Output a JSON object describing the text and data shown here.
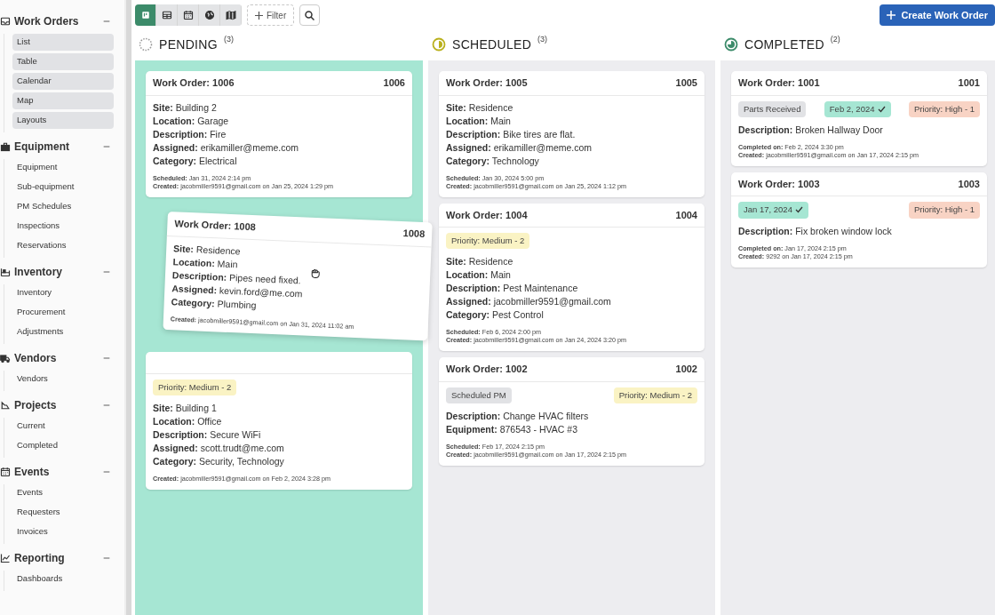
{
  "sidebar": {
    "groups": [
      {
        "title": "Work Orders",
        "expanded": true,
        "kind": "buttons",
        "items": [
          "List",
          "Table",
          "Calendar",
          "Map",
          "Layouts"
        ]
      },
      {
        "title": "Equipment",
        "expanded": true,
        "kind": "links",
        "items": [
          "Equipment",
          "Sub-equipment",
          "PM Schedules",
          "Inspections",
          "Reservations"
        ]
      },
      {
        "title": "Inventory",
        "expanded": true,
        "kind": "links",
        "items": [
          "Inventory",
          "Procurement",
          "Adjustments"
        ]
      },
      {
        "title": "Vendors",
        "expanded": true,
        "kind": "links",
        "items": [
          "Vendors"
        ]
      },
      {
        "title": "Projects",
        "expanded": true,
        "kind": "links",
        "items": [
          "Current",
          "Completed"
        ]
      },
      {
        "title": "Events",
        "expanded": true,
        "kind": "links",
        "items": [
          "Events",
          "Requesters",
          "Invoices"
        ]
      },
      {
        "title": "Reporting",
        "expanded": true,
        "kind": "links",
        "items": [
          "Dashboards"
        ]
      }
    ]
  },
  "toolbar": {
    "views": [
      {
        "selected": true
      },
      {
        "selected": false
      },
      {
        "selected": false
      },
      {
        "selected": false
      },
      {
        "selected": false
      }
    ],
    "filter": "Filter",
    "create": "Create Work Order"
  },
  "columns": [
    {
      "title": "PENDING",
      "count": "(3)",
      "highlighted": true,
      "cards": [
        {
          "title": "Work Order: 1006",
          "number": "1006",
          "fields": [
            "**Site:** Building 2",
            "**Location:** Garage",
            "**Description:** Fire",
            "**Assigned:** erikamiller@meme.com",
            "**Category:** Electrical"
          ],
          "footer": [
            "**Scheduled:** Jan 31, 2024 2:14 pm",
            "**Created:** jacobmiller9591@gmail.com on Jan 25, 2024 1:29 pm"
          ]
        },
        {
          "badges": [
            {
              "kind": "priority",
              "text": "Priority: Medium - 2",
              "color": "#faf3c4"
            }
          ],
          "fields": [
            "**Site:** Building 1",
            "**Location:** Office",
            "**Description:** Secure WiFi",
            "**Assigned:** scott.trudt@me.com",
            "**Category:** Security, Technology"
          ],
          "footer": [
            "**Created:** jacobmiller9591@gmail.com on Feb 2, 2024 3:28 pm"
          ]
        }
      ],
      "dragged_card": {
        "title": "Work Order: 1008",
        "number": "1008",
        "fields": [
          "**Site:** Residence",
          "**Location:** Main",
          "**Description:** Pipes need fixed.",
          "**Assigned:** kevin.ford@me.com",
          "**Category:** Plumbing"
        ],
        "footer": [
          "**Created:** jacobmiller9591@gmail.com on Jan 31, 2024 11:02 am"
        ]
      }
    },
    {
      "title": "SCHEDULED",
      "count": "(3)",
      "highlighted": false,
      "cards": [
        {
          "title": "Work Order: 1005",
          "number": "1005",
          "fields": [
            "**Site:** Residence",
            "**Location:** Main",
            "**Description:** Bike tires are flat.",
            "**Assigned:** erikamiller@meme.com",
            "**Category:** Technology"
          ],
          "footer": [
            "**Scheduled:** Jan 30, 2024 5:00 pm",
            "**Created:** jacobmiller9591@gmail.com on Jan 25, 2024 1:12 pm"
          ]
        },
        {
          "title": "Work Order: 1004",
          "number": "1004",
          "badges": [
            {
              "kind": "priority",
              "text": "Priority: Medium - 2",
              "color": "#faf3c4"
            }
          ],
          "fields": [
            "**Site:** Residence",
            "**Location:** Main",
            "**Description:** Pest Maintenance",
            "**Assigned:** jacobmiller9591@gmail.com",
            "**Category:** Pest Control"
          ],
          "footer": [
            "**Scheduled:** Feb 6, 2024 2:00 pm",
            "**Created:** jacobmiller9591@gmail.com on Jan 24, 2024 3:20 pm"
          ]
        },
        {
          "title": "Work Order: 1002",
          "number": "1002",
          "badges": [
            {
              "kind": "status",
              "text": "Scheduled PM"
            },
            {
              "kind": "priority",
              "text": "Priority: Medium - 2",
              "color": "#faf3c4"
            }
          ],
          "fields": [
            "**Description:** Change HVAC filters",
            "**Equipment:** 876543 - HVAC #3"
          ],
          "footer": [
            "**Scheduled:** Feb 17, 2024 2:15 pm",
            "**Created:** jacobmiller9591@gmail.com on Jan 17, 2024 2:15 pm"
          ]
        }
      ]
    },
    {
      "title": "COMPLETED",
      "count": "(2)",
      "highlighted": false,
      "cards": [
        {
          "title": "Work Order: 1001",
          "number": "1001",
          "badges": [
            {
              "kind": "status",
              "text": "Parts Received"
            },
            {
              "kind": "date",
              "text": "Feb 2, 2024"
            },
            {
              "kind": "priority",
              "text": "Priority: High - 1",
              "color": "#f8d3c4"
            }
          ],
          "fields": [
            "**Description:** Broken Hallway Door"
          ],
          "footer": [
            "**Completed on:** Feb 2, 2024 3:30 pm",
            "**Created:** jacobmiller9591@gmail.com on Jan 17, 2024 2:15 pm"
          ]
        },
        {
          "title": "Work Order: 1003",
          "number": "1003",
          "badges": [
            {
              "kind": "date",
              "text": "Jan 17, 2024"
            },
            {
              "kind": "priority",
              "text": "Priority: High - 1",
              "color": "#f8d3c4"
            }
          ],
          "fields": [
            "**Description:** Fix broken window lock"
          ],
          "footer": [
            "**Completed on:** Jan 17, 2024 2:15 pm",
            "**Created:** 9292 on Jan 17, 2024 2:15 pm"
          ]
        }
      ]
    }
  ]
}
